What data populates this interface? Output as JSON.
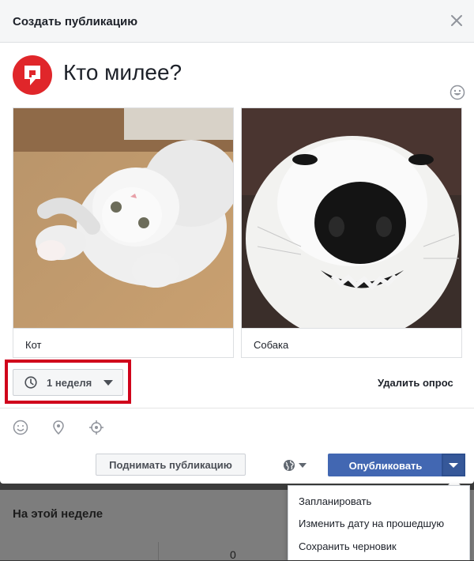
{
  "dialog": {
    "title": "Создать публикацию",
    "close_icon": "close-icon"
  },
  "post": {
    "text": "Кто милее?",
    "avatar_icon": "page-logo-icon",
    "emoji_icon": "emoji-icon"
  },
  "poll": {
    "options": [
      {
        "label": "Кот",
        "image": "cat-gif-image"
      },
      {
        "label": "Собака",
        "image": "dog-gif-image"
      }
    ],
    "duration_label": "1 неделя",
    "delete_label": "Удалить опрос"
  },
  "tools": [
    "feeling-icon",
    "location-icon",
    "target-icon"
  ],
  "footer": {
    "boost_label": "Поднимать публикацию",
    "audience_icon": "globe-icon",
    "publish_label": "Опубликовать"
  },
  "publish_menu": {
    "items": [
      {
        "label": "Запланировать"
      },
      {
        "label": "Изменить дату на прошедшую"
      },
      {
        "label": "Сохранить черновик"
      }
    ]
  },
  "background_page": {
    "section_title": "На этой неделе",
    "count": "0"
  },
  "colors": {
    "accent": "#4267b2",
    "highlight": "#d0021b",
    "brand_red": "#e0262a"
  }
}
